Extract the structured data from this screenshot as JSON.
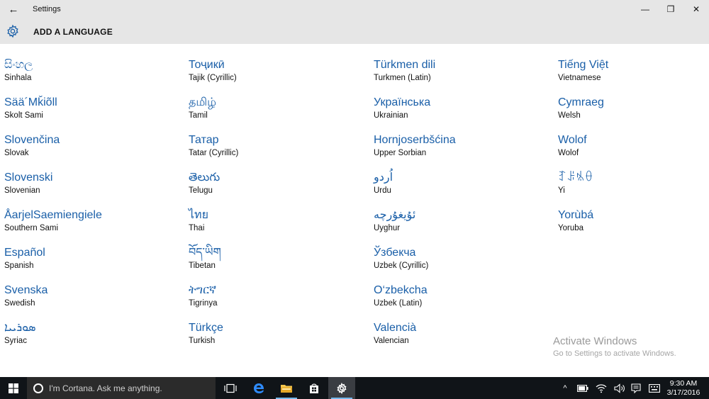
{
  "window": {
    "title": "Settings",
    "back_glyph": "←",
    "minimize_glyph": "—",
    "maximize_glyph": "❐",
    "close_glyph": "✕"
  },
  "header": {
    "title": "ADD A LANGUAGE",
    "icon": "gear-icon"
  },
  "columns": [
    [
      {
        "native": "සිංහල",
        "english": "Sinhala"
      },
      {
        "native": "Sää´Mǩiõll",
        "english": "Skolt Sami"
      },
      {
        "native": "Slovenčina",
        "english": "Slovak"
      },
      {
        "native": "Slovenski",
        "english": "Slovenian"
      },
      {
        "native": "ÅarjelSaemiengiele",
        "english": "Southern Sami"
      },
      {
        "native": "Español",
        "english": "Spanish"
      },
      {
        "native": "Svenska",
        "english": "Swedish"
      },
      {
        "native": "ܣܘܪܝܝܐ",
        "english": "Syriac"
      }
    ],
    [
      {
        "native": "Тоҷикӣ",
        "english": "Tajik (Cyrillic)"
      },
      {
        "native": "தமிழ்",
        "english": "Tamil"
      },
      {
        "native": "Татар",
        "english": "Tatar (Cyrillic)"
      },
      {
        "native": "తెలుగు",
        "english": "Telugu"
      },
      {
        "native": "ไทย",
        "english": "Thai"
      },
      {
        "native": "བོད་ཡིག",
        "english": "Tibetan"
      },
      {
        "native": "ትግርኛ",
        "english": "Tigrinya"
      },
      {
        "native": "Türkçe",
        "english": "Turkish"
      }
    ],
    [
      {
        "native": "Türkmen dili",
        "english": "Turkmen (Latin)"
      },
      {
        "native": "Українська",
        "english": "Ukrainian"
      },
      {
        "native": "Hornjoserbšćina",
        "english": "Upper Sorbian"
      },
      {
        "native": "اُردو",
        "english": "Urdu"
      },
      {
        "native": "ئۇيغۇرچە",
        "english": "Uyghur"
      },
      {
        "native": "Ўзбекча",
        "english": "Uzbek (Cyrillic)"
      },
      {
        "native": "O‘zbekcha",
        "english": "Uzbek (Latin)"
      },
      {
        "native": "Valencià",
        "english": "Valencian"
      }
    ],
    [
      {
        "native": "Tiếng Việt",
        "english": "Vietnamese"
      },
      {
        "native": "Cymraeg",
        "english": "Welsh"
      },
      {
        "native": "Wolof",
        "english": "Wolof"
      },
      {
        "native": "ꆈꌠꁱꂷ",
        "english": "Yi"
      },
      {
        "native": "Yorùbá",
        "english": "Yoruba"
      }
    ]
  ],
  "watermark": {
    "title": "Activate Windows",
    "subtitle": "Go to Settings to activate Windows."
  },
  "taskbar": {
    "cortana_placeholder": "I'm Cortana. Ask me anything.",
    "apps": [
      "task-view-icon",
      "edge-icon",
      "file-explorer-icon",
      "store-icon",
      "settings-icon"
    ],
    "clock_time": "9:30 AM",
    "clock_date": "3/17/2016",
    "tray_chevron": "^"
  },
  "colors": {
    "accent": "#1a5fa8",
    "header_bg": "#e6e6e6",
    "taskbar_bg": "#101418"
  }
}
